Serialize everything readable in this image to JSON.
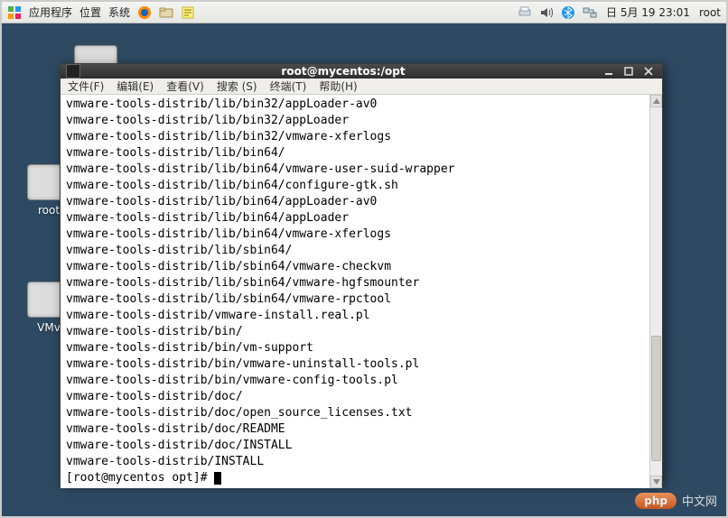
{
  "panel": {
    "menus": [
      {
        "label": "应用程序"
      },
      {
        "label": "位置"
      },
      {
        "label": "系统"
      }
    ],
    "clock": "日 5月 19 23:01",
    "user": "root"
  },
  "desktop": {
    "icons": [
      {
        "label": ""
      },
      {
        "label": "root"
      },
      {
        "label": "VMv"
      }
    ]
  },
  "terminal_window": {
    "title": "root@mycentos:/opt",
    "menubar": [
      {
        "label": "文件(F)"
      },
      {
        "label": "编辑(E)"
      },
      {
        "label": "查看(V)"
      },
      {
        "label": "搜索 (S)"
      },
      {
        "label": "终端(T)"
      },
      {
        "label": "帮助(H)"
      }
    ],
    "lines": [
      "vmware-tools-distrib/lib/bin32/appLoader-av0",
      "vmware-tools-distrib/lib/bin32/appLoader",
      "vmware-tools-distrib/lib/bin32/vmware-xferlogs",
      "vmware-tools-distrib/lib/bin64/",
      "vmware-tools-distrib/lib/bin64/vmware-user-suid-wrapper",
      "vmware-tools-distrib/lib/bin64/configure-gtk.sh",
      "vmware-tools-distrib/lib/bin64/appLoader-av0",
      "vmware-tools-distrib/lib/bin64/appLoader",
      "vmware-tools-distrib/lib/bin64/vmware-xferlogs",
      "vmware-tools-distrib/lib/sbin64/",
      "vmware-tools-distrib/lib/sbin64/vmware-checkvm",
      "vmware-tools-distrib/lib/sbin64/vmware-hgfsmounter",
      "vmware-tools-distrib/lib/sbin64/vmware-rpctool",
      "vmware-tools-distrib/vmware-install.real.pl",
      "vmware-tools-distrib/bin/",
      "vmware-tools-distrib/bin/vm-support",
      "vmware-tools-distrib/bin/vmware-uninstall-tools.pl",
      "vmware-tools-distrib/bin/vmware-config-tools.pl",
      "vmware-tools-distrib/doc/",
      "vmware-tools-distrib/doc/open_source_licenses.txt",
      "vmware-tools-distrib/doc/README",
      "vmware-tools-distrib/doc/INSTALL",
      "vmware-tools-distrib/INSTALL"
    ],
    "prompt": "[root@mycentos opt]# "
  },
  "watermark": {
    "brand": "php",
    "cn": "中文网"
  }
}
